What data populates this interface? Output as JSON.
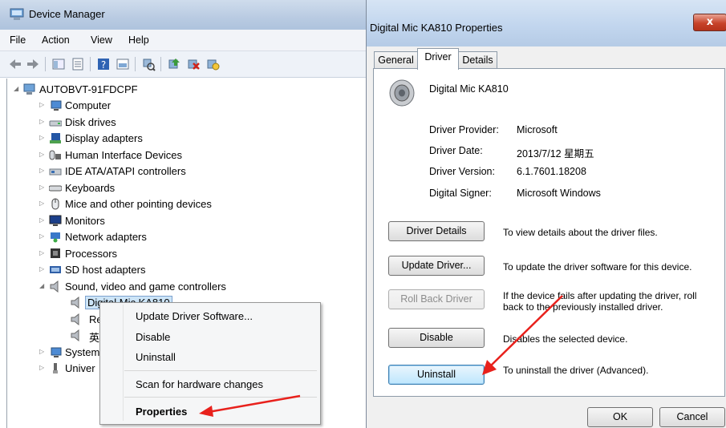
{
  "device_manager": {
    "title": "Device Manager",
    "menu": [
      "File",
      "Action",
      "View",
      "Help"
    ],
    "tree": {
      "root": "AUTOBVT-91FDCPF",
      "categories": [
        "Computer",
        "Disk drives",
        "Display adapters",
        "Human Interface Devices",
        "IDE ATA/ATAPI controllers",
        "Keyboards",
        "Mice and other pointing devices",
        "Monitors",
        "Network adapters",
        "Processors",
        "SD host adapters",
        "Sound, video and game controllers"
      ],
      "sound_children": [
        "Digital Mic KA810",
        "Re",
        "英"
      ],
      "after": [
        "System",
        "Univer"
      ]
    },
    "context_menu": {
      "items": [
        "Update Driver Software...",
        "Disable",
        "Uninstall",
        "Scan for hardware changes",
        "Properties"
      ]
    }
  },
  "properties": {
    "title": "Digital Mic KA810 Properties",
    "close_label": "x",
    "tabs": [
      "General",
      "Driver",
      "Details"
    ],
    "device_name": "Digital Mic KA810",
    "fields": [
      {
        "label": "Driver Provider:",
        "value": "Microsoft"
      },
      {
        "label": "Driver Date:",
        "value": "2013/7/12 星期五"
      },
      {
        "label": "Driver Version:",
        "value": "6.1.7601.18208"
      },
      {
        "label": "Digital Signer:",
        "value": "Microsoft Windows"
      }
    ],
    "buttons": [
      {
        "label": "Driver Details",
        "desc": "To view details about the driver files."
      },
      {
        "label": "Update Driver...",
        "desc": "To update the driver software for this device."
      },
      {
        "label": "Roll Back Driver",
        "desc": "If the device fails after updating the driver, roll back to the previously installed driver."
      },
      {
        "label": "Disable",
        "desc": "Disables the selected device."
      },
      {
        "label": "Uninstall",
        "desc": "To uninstall the driver (Advanced)."
      }
    ],
    "ok_label": "OK",
    "cancel_label": "Cancel"
  },
  "colors": {
    "annotation_arrow": "#e8211c"
  }
}
